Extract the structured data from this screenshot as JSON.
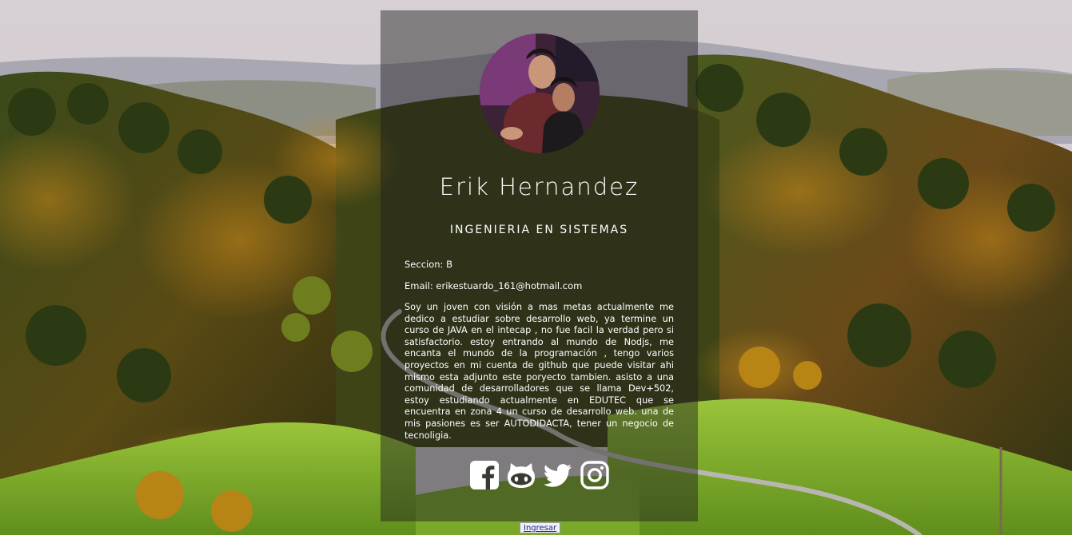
{
  "profile": {
    "name": "Erik Hernandez",
    "title": "INGENIERIA EN SISTEMAS",
    "seccion": "Seccion: B",
    "email": "Email: erikestuardo_161@hotmail.com",
    "bio": "Soy un joven con visión a mas metas actualmente me dedico a estudiar sobre desarrollo web, ya termine un curso de JAVA en el intecap , no fue facil la verdad pero si satisfactorio. estoy entrando al mundo de Nodjs, me encanta el mundo de la programación , tengo varios proyectos en mi cuenta de github que puede visitar ahi mismo esta adjunto este poryecto tambien. asisto a una comunidad de desarrolladores que se llama Dev+502, estoy estudiando actualmente en EDUTEC que se encuentra en zona 4 un curso de desarrollo web. una de mis pasiones es ser AUTODIDACTA, tener un negocio de tecnoligia."
  },
  "social": {
    "icons": [
      "facebook-icon",
      "github-icon",
      "twitter-icon",
      "instagram-icon"
    ]
  },
  "login": {
    "label": "Ingresar"
  },
  "colors": {
    "card_bg": "rgba(28,28,28,0.45)",
    "text": "#ffffff",
    "sky": "#d8d3d6",
    "grass": "#7cae2a"
  }
}
